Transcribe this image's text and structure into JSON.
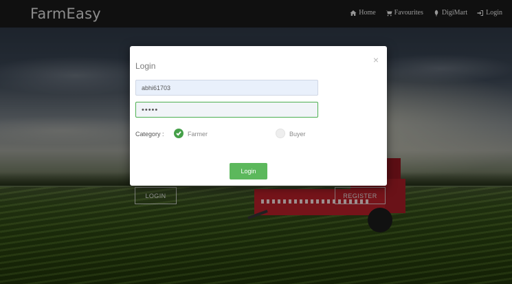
{
  "navbar": {
    "brand": "FarmEasy",
    "links": [
      {
        "label": "Home",
        "icon": "home-icon"
      },
      {
        "label": "Favourites",
        "icon": "cart-icon"
      },
      {
        "label": "DigiMart",
        "icon": "leaf-icon"
      },
      {
        "label": "Login",
        "icon": "login-icon"
      }
    ]
  },
  "hero": {
    "login_label": "LOGIN",
    "register_label": "REGISTER"
  },
  "modal": {
    "title": "Login",
    "close_symbol": "×",
    "username_value": "abhi61703",
    "password_value": "•••••",
    "category_label": "Category :",
    "options": [
      {
        "label": "Farmer",
        "selected": true
      },
      {
        "label": "Buyer",
        "selected": false
      }
    ],
    "submit_label": "Login"
  },
  "colors": {
    "navbar_bg": "#1a1a1a",
    "accent_green": "#5cb85c",
    "selected_radio": "#45a049"
  }
}
